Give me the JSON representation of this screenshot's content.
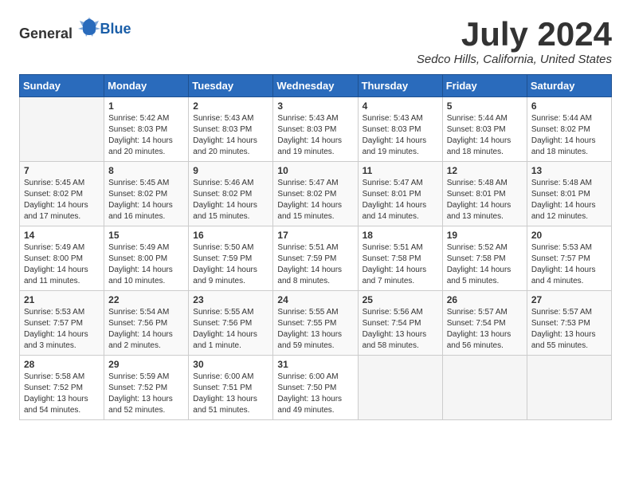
{
  "header": {
    "logo_general": "General",
    "logo_blue": "Blue",
    "month_title": "July 2024",
    "subtitle": "Sedco Hills, California, United States"
  },
  "days_of_week": [
    "Sunday",
    "Monday",
    "Tuesday",
    "Wednesday",
    "Thursday",
    "Friday",
    "Saturday"
  ],
  "weeks": [
    [
      {
        "day": "",
        "info": ""
      },
      {
        "day": "1",
        "info": "Sunrise: 5:42 AM\nSunset: 8:03 PM\nDaylight: 14 hours\nand 20 minutes."
      },
      {
        "day": "2",
        "info": "Sunrise: 5:43 AM\nSunset: 8:03 PM\nDaylight: 14 hours\nand 20 minutes."
      },
      {
        "day": "3",
        "info": "Sunrise: 5:43 AM\nSunset: 8:03 PM\nDaylight: 14 hours\nand 19 minutes."
      },
      {
        "day": "4",
        "info": "Sunrise: 5:43 AM\nSunset: 8:03 PM\nDaylight: 14 hours\nand 19 minutes."
      },
      {
        "day": "5",
        "info": "Sunrise: 5:44 AM\nSunset: 8:03 PM\nDaylight: 14 hours\nand 18 minutes."
      },
      {
        "day": "6",
        "info": "Sunrise: 5:44 AM\nSunset: 8:02 PM\nDaylight: 14 hours\nand 18 minutes."
      }
    ],
    [
      {
        "day": "7",
        "info": "Sunrise: 5:45 AM\nSunset: 8:02 PM\nDaylight: 14 hours\nand 17 minutes."
      },
      {
        "day": "8",
        "info": "Sunrise: 5:45 AM\nSunset: 8:02 PM\nDaylight: 14 hours\nand 16 minutes."
      },
      {
        "day": "9",
        "info": "Sunrise: 5:46 AM\nSunset: 8:02 PM\nDaylight: 14 hours\nand 15 minutes."
      },
      {
        "day": "10",
        "info": "Sunrise: 5:47 AM\nSunset: 8:02 PM\nDaylight: 14 hours\nand 15 minutes."
      },
      {
        "day": "11",
        "info": "Sunrise: 5:47 AM\nSunset: 8:01 PM\nDaylight: 14 hours\nand 14 minutes."
      },
      {
        "day": "12",
        "info": "Sunrise: 5:48 AM\nSunset: 8:01 PM\nDaylight: 14 hours\nand 13 minutes."
      },
      {
        "day": "13",
        "info": "Sunrise: 5:48 AM\nSunset: 8:01 PM\nDaylight: 14 hours\nand 12 minutes."
      }
    ],
    [
      {
        "day": "14",
        "info": "Sunrise: 5:49 AM\nSunset: 8:00 PM\nDaylight: 14 hours\nand 11 minutes."
      },
      {
        "day": "15",
        "info": "Sunrise: 5:49 AM\nSunset: 8:00 PM\nDaylight: 14 hours\nand 10 minutes."
      },
      {
        "day": "16",
        "info": "Sunrise: 5:50 AM\nSunset: 7:59 PM\nDaylight: 14 hours\nand 9 minutes."
      },
      {
        "day": "17",
        "info": "Sunrise: 5:51 AM\nSunset: 7:59 PM\nDaylight: 14 hours\nand 8 minutes."
      },
      {
        "day": "18",
        "info": "Sunrise: 5:51 AM\nSunset: 7:58 PM\nDaylight: 14 hours\nand 7 minutes."
      },
      {
        "day": "19",
        "info": "Sunrise: 5:52 AM\nSunset: 7:58 PM\nDaylight: 14 hours\nand 5 minutes."
      },
      {
        "day": "20",
        "info": "Sunrise: 5:53 AM\nSunset: 7:57 PM\nDaylight: 14 hours\nand 4 minutes."
      }
    ],
    [
      {
        "day": "21",
        "info": "Sunrise: 5:53 AM\nSunset: 7:57 PM\nDaylight: 14 hours\nand 3 minutes."
      },
      {
        "day": "22",
        "info": "Sunrise: 5:54 AM\nSunset: 7:56 PM\nDaylight: 14 hours\nand 2 minutes."
      },
      {
        "day": "23",
        "info": "Sunrise: 5:55 AM\nSunset: 7:56 PM\nDaylight: 14 hours\nand 1 minute."
      },
      {
        "day": "24",
        "info": "Sunrise: 5:55 AM\nSunset: 7:55 PM\nDaylight: 13 hours\nand 59 minutes."
      },
      {
        "day": "25",
        "info": "Sunrise: 5:56 AM\nSunset: 7:54 PM\nDaylight: 13 hours\nand 58 minutes."
      },
      {
        "day": "26",
        "info": "Sunrise: 5:57 AM\nSunset: 7:54 PM\nDaylight: 13 hours\nand 56 minutes."
      },
      {
        "day": "27",
        "info": "Sunrise: 5:57 AM\nSunset: 7:53 PM\nDaylight: 13 hours\nand 55 minutes."
      }
    ],
    [
      {
        "day": "28",
        "info": "Sunrise: 5:58 AM\nSunset: 7:52 PM\nDaylight: 13 hours\nand 54 minutes."
      },
      {
        "day": "29",
        "info": "Sunrise: 5:59 AM\nSunset: 7:52 PM\nDaylight: 13 hours\nand 52 minutes."
      },
      {
        "day": "30",
        "info": "Sunrise: 6:00 AM\nSunset: 7:51 PM\nDaylight: 13 hours\nand 51 minutes."
      },
      {
        "day": "31",
        "info": "Sunrise: 6:00 AM\nSunset: 7:50 PM\nDaylight: 13 hours\nand 49 minutes."
      },
      {
        "day": "",
        "info": ""
      },
      {
        "day": "",
        "info": ""
      },
      {
        "day": "",
        "info": ""
      }
    ]
  ]
}
